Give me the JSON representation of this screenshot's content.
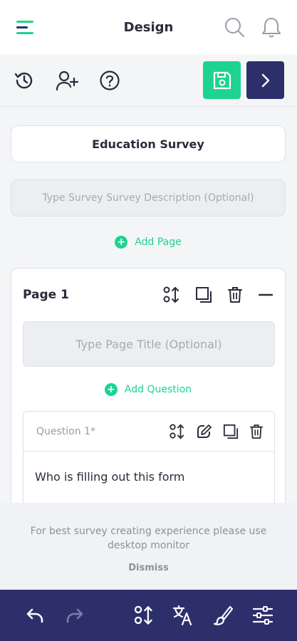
{
  "header": {
    "title": "Design",
    "icons": [
      "menu-icon",
      "search-icon",
      "bell-icon"
    ]
  },
  "toolbar": {
    "icons": [
      "history-icon",
      "add-user-icon",
      "help-icon",
      "save-icon",
      "chevron-right-icon"
    ]
  },
  "survey": {
    "title": "Education Survey",
    "description_placeholder": "Type Survey Survey Description (Optional)"
  },
  "add_page_label": "Add Page",
  "page": {
    "label": "Page 1",
    "title_placeholder": "Type Page Title (Optional)",
    "add_question_label": "Add Question",
    "question": {
      "label": "Question 1*",
      "text": "Who is filling out this form"
    }
  },
  "notice": {
    "message": "For best survey creating experience please use desktop monitor",
    "dismiss_label": "Dismiss"
  },
  "bottom_bar": {
    "icons": [
      "undo-icon",
      "redo-icon",
      "reorder-icon",
      "translate-icon",
      "brush-icon",
      "sliders-icon"
    ]
  },
  "colors": {
    "accent_green": "#1ed390",
    "navy": "#2d2f6b"
  }
}
